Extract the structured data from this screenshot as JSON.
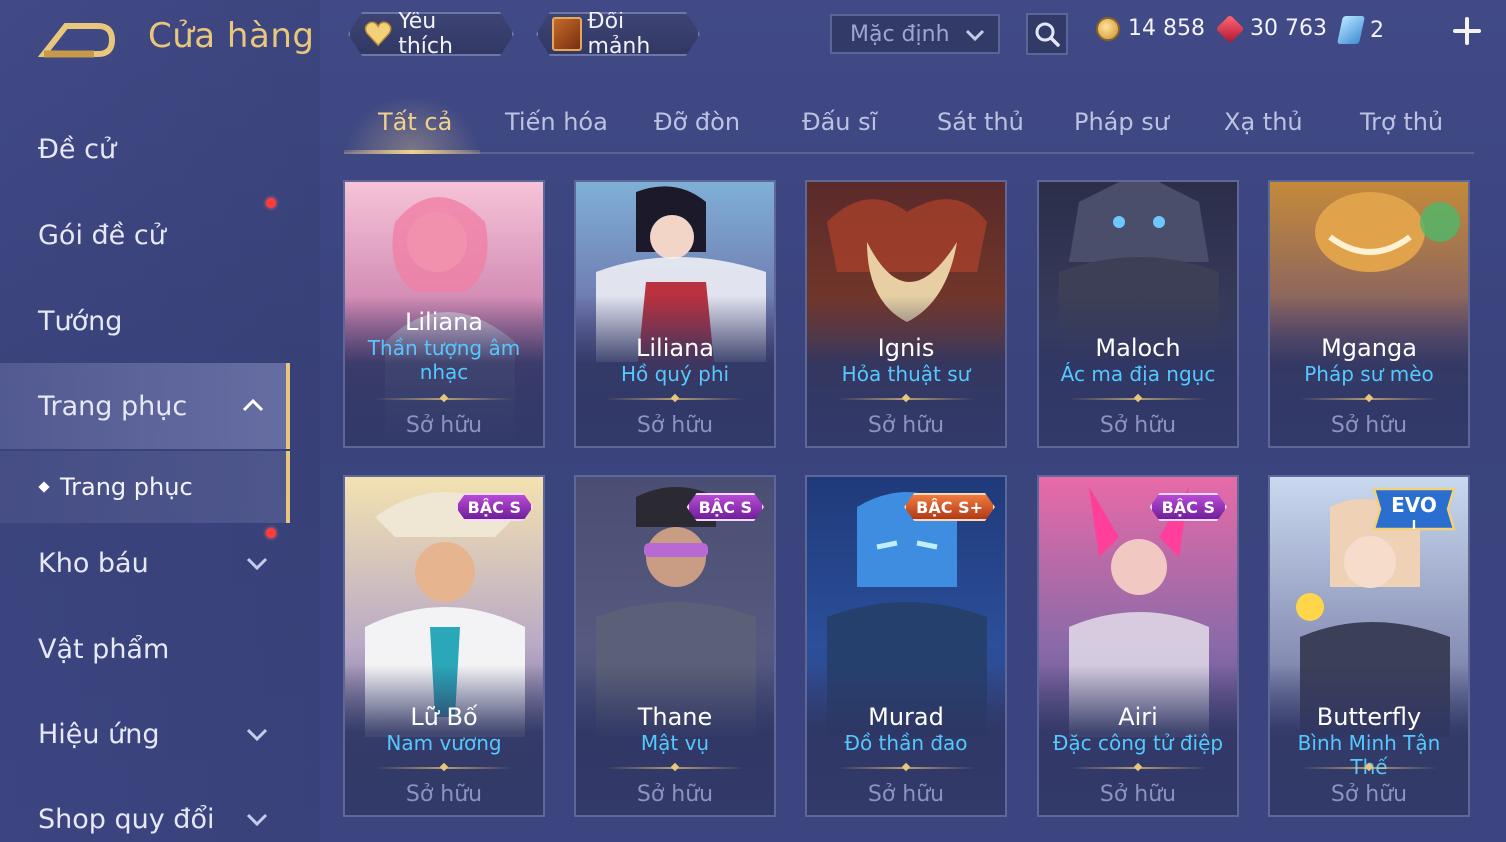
{
  "header": {
    "title": "Cửa hàng",
    "favorites_label": "Yêu thích",
    "shard_exchange_label": "Đổi mảnh",
    "sort_selected": "Mặc định"
  },
  "currencies": {
    "gold": "14 858",
    "ruby": "30 763",
    "ticket": "2"
  },
  "sidebar": {
    "items": [
      {
        "label": "Đề cử"
      },
      {
        "label": "Gói đề cử"
      },
      {
        "label": "Tướng"
      },
      {
        "label": "Trang phục"
      },
      {
        "label": "Kho báu"
      },
      {
        "label": "Vật phẩm"
      },
      {
        "label": "Hiệu ứng"
      },
      {
        "label": "Shop quy đổi"
      }
    ],
    "sub_item": {
      "label": "Trang phục"
    }
  },
  "tabs": [
    {
      "label": "Tất cả"
    },
    {
      "label": "Tiến hóa"
    },
    {
      "label": "Đỡ đòn"
    },
    {
      "label": "Đấu sĩ"
    },
    {
      "label": "Sát thủ"
    },
    {
      "label": "Pháp sư"
    },
    {
      "label": "Xạ thủ"
    },
    {
      "label": "Trợ thủ"
    }
  ],
  "cards": [
    {
      "hero": "Liliana",
      "skin": "Thần tượng âm nhạc",
      "status": "Sở hữu",
      "badge": ""
    },
    {
      "hero": "Liliana",
      "skin": "Hồ quý phi",
      "status": "Sở hữu",
      "badge": ""
    },
    {
      "hero": "Ignis",
      "skin": "Hỏa thuật sư",
      "status": "Sở hữu",
      "badge": ""
    },
    {
      "hero": "Maloch",
      "skin": "Ác ma địa ngục",
      "status": "Sở hữu",
      "badge": ""
    },
    {
      "hero": "Mganga",
      "skin": "Pháp sư mèo",
      "status": "Sở hữu",
      "badge": ""
    },
    {
      "hero": "Lữ Bố",
      "skin": "Nam vương",
      "status": "Sở hữu",
      "badge": "BẬC S"
    },
    {
      "hero": "Thane",
      "skin": "Mật vụ",
      "status": "Sở hữu",
      "badge": "BẬC S"
    },
    {
      "hero": "Murad",
      "skin": "Đồ thần đao",
      "status": "Sở hữu",
      "badge": "BẬC S+"
    },
    {
      "hero": "Airi",
      "skin": "Đặc công tử điệp",
      "status": "Sở hữu",
      "badge": "BẬC S"
    },
    {
      "hero": "Butterfly",
      "skin": "Bình Minh Tận Thế",
      "status": "Sở hữu",
      "badge": "EVO"
    }
  ],
  "evo_badge": {
    "label": "EVO",
    "level": "I"
  },
  "colors": {
    "accent_gold": "#e8c77c",
    "skin_name_blue": "#55c8ff",
    "background": "#3c4580",
    "notification_red": "#ff3b3b"
  }
}
